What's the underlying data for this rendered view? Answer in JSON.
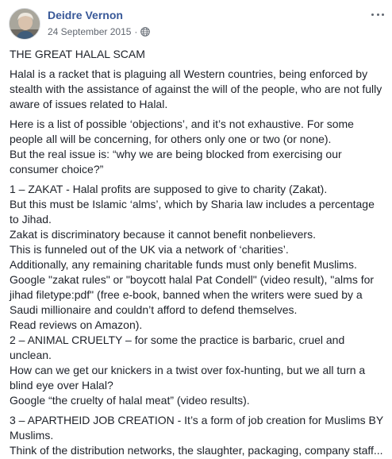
{
  "post": {
    "author": "Deidre Vernon",
    "date": "24 September 2015",
    "separator": "·",
    "privacy_icon": "globe-icon",
    "menu_icon": "more-options-icon",
    "paragraphs": [
      [
        "THE GREAT HALAL SCAM"
      ],
      [
        "Halal is a racket that is plaguing all Western countries, being enforced by",
        "stealth with the assistance of against the will of the people, who are not fully",
        "aware of issues related to Halal."
      ],
      [
        "Here is a list of possible ‘objections’, and it’s not exhaustive. For some",
        "people all will be concerning, for others only one or two (or none).",
        "But the real issue is: “why we are being blocked from exercising our",
        "consumer choice?”"
      ],
      [
        "1 – ZAKAT - Halal profits are supposed to give to charity (Zakat).",
        "But this must be Islamic ‘alms’, which by Sharia law includes a percentage",
        "to Jihad.",
        "Zakat is discriminatory because it cannot benefit nonbelievers.",
        "This is funneled out of the UK via a network of ‘charities’.",
        "Additionally, any remaining charitable funds must only benefit Muslims.",
        "Google \"zakat rules\" or \"boycott halal Pat Condell\" (video result), \"alms for",
        "jihad filetype:pdf\" (free e-book, banned when the writers were sued by a",
        "Saudi millionaire and couldn’t afford to defend themselves.",
        "Read reviews on Amazon).",
        "2 – ANIMAL CRUELTY – for some the practice is barbaric, cruel and",
        "unclean.",
        "How can we get our knickers in a twist over fox-hunting, but we all turn a",
        "blind eye over Halal?",
        "Google “the cruelty of halal meat” (video results)."
      ],
      [
        "3 – APARTHEID JOB CREATION - It’s a form of job creation for Muslims BY",
        "Muslims.",
        "Think of the distribution networks, the slaughter, packaging, company staff..."
      ]
    ]
  },
  "colors": {
    "author": "#385898",
    "meta": "#616770",
    "text": "#1d2129"
  }
}
